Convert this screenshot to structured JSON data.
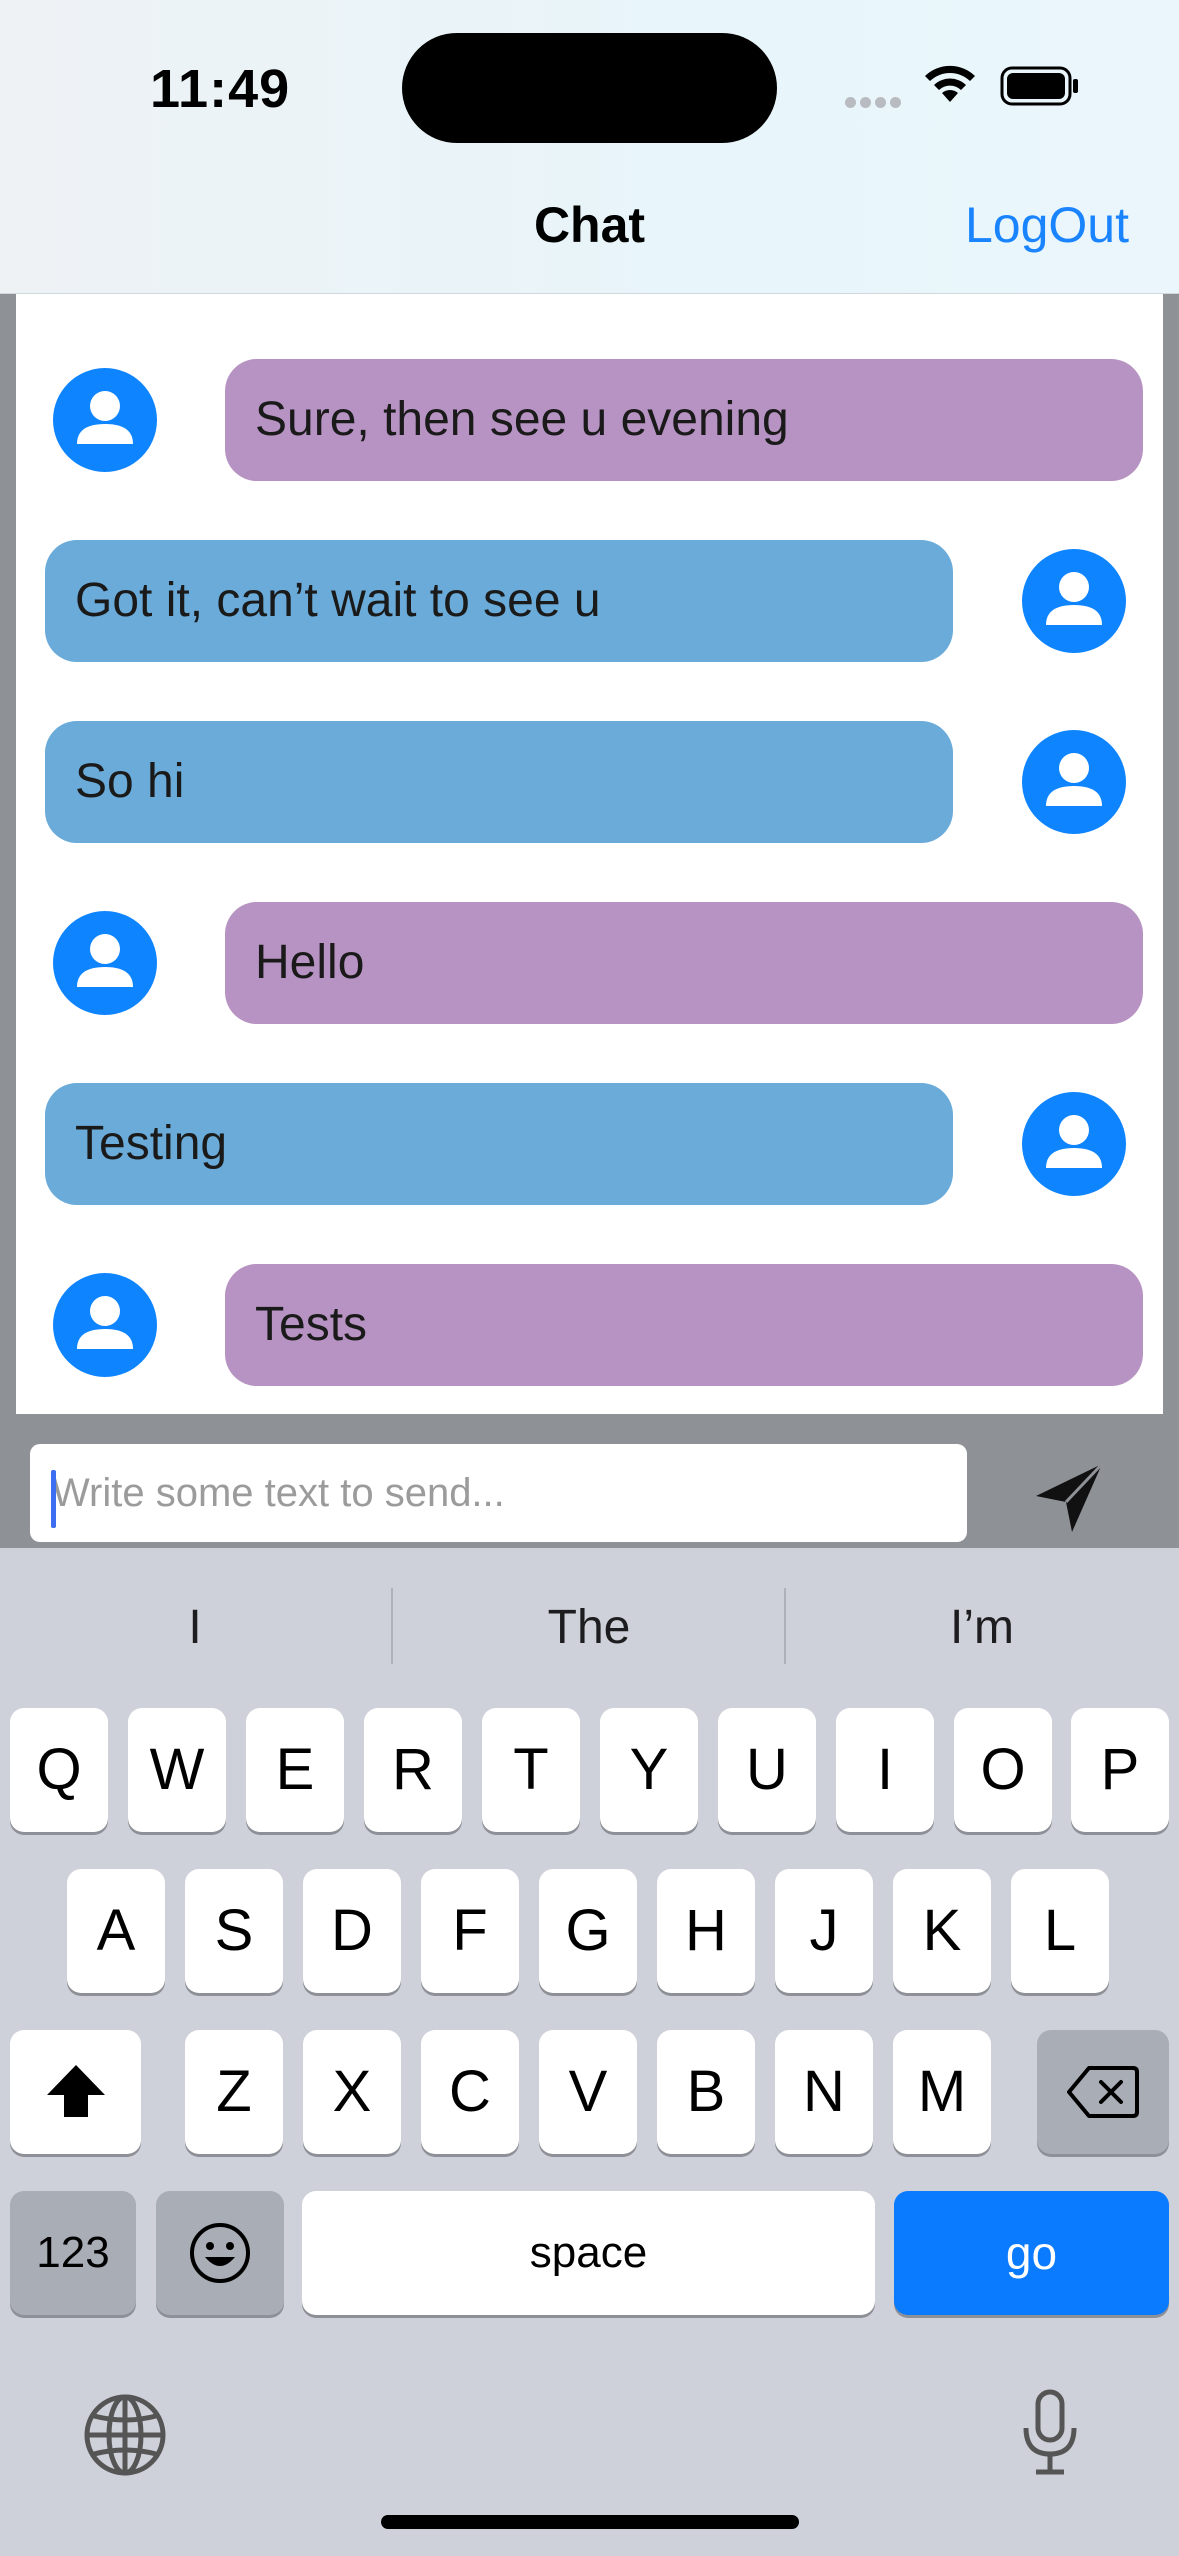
{
  "status_bar": {
    "time": "11:49"
  },
  "nav": {
    "title": "Chat",
    "logout_label": "LogOut"
  },
  "messages": [
    {
      "text": "Sure, then see u evening",
      "side": "other"
    },
    {
      "text": "Got it, can’t wait to see u",
      "side": "me"
    },
    {
      "text": "So hi",
      "side": "me"
    },
    {
      "text": "Hello",
      "side": "other"
    },
    {
      "text": "Testing",
      "side": "me"
    },
    {
      "text": "Tests",
      "side": "other"
    }
  ],
  "composer": {
    "placeholder": "Write some text to send...",
    "send_icon": "paper-plane-icon"
  },
  "keyboard": {
    "suggestions": [
      "I",
      "The",
      "I’m"
    ],
    "row1": [
      "Q",
      "W",
      "E",
      "R",
      "T",
      "Y",
      "U",
      "I",
      "O",
      "P"
    ],
    "row2": [
      "A",
      "S",
      "D",
      "F",
      "G",
      "H",
      "J",
      "K",
      "L"
    ],
    "row3": [
      "Z",
      "X",
      "C",
      "V",
      "B",
      "N",
      "M"
    ],
    "numbers_label": "123",
    "space_label": "space",
    "go_label": "go"
  },
  "colors": {
    "accent": "#1a84ff",
    "bubble_me": "#6aabd9",
    "bubble_other": "#b793c3",
    "avatar": "#0f84ff",
    "go_key": "#0a7aff"
  }
}
